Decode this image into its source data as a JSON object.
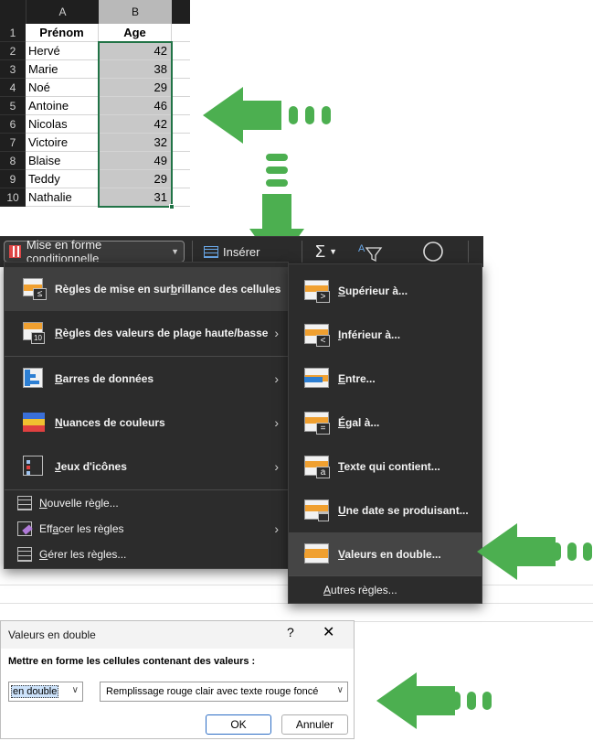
{
  "sheet": {
    "columns": [
      "A",
      "B"
    ],
    "header_row": {
      "num": "1",
      "a": "Prénom",
      "b": "Age"
    },
    "rows": [
      {
        "num": "2",
        "name": "Hervé",
        "age": "42"
      },
      {
        "num": "3",
        "name": "Marie",
        "age": "38"
      },
      {
        "num": "4",
        "name": "Noé",
        "age": "29"
      },
      {
        "num": "5",
        "name": "Antoine",
        "age": "46"
      },
      {
        "num": "6",
        "name": "Nicolas",
        "age": "42"
      },
      {
        "num": "7",
        "name": "Victoire",
        "age": "32"
      },
      {
        "num": "8",
        "name": "Blaise",
        "age": "49"
      },
      {
        "num": "9",
        "name": "Teddy",
        "age": "29"
      },
      {
        "num": "10",
        "name": "Nathalie",
        "age": "31"
      }
    ]
  },
  "ribbon": {
    "conditional_formatting": "Mise en forme conditionnelle",
    "insert": "Insérer",
    "sum_symbol": "Σ"
  },
  "main_menu": {
    "items": [
      {
        "pre": "Règles de mise en sur",
        "key": "b",
        "post": "rillance des cellules"
      },
      {
        "pre": "",
        "key": "R",
        "post": "ègles des valeurs de plage haute/basse"
      },
      {
        "pre": "",
        "key": "B",
        "post": "arres de données"
      },
      {
        "pre": "",
        "key": "N",
        "post": "uances de couleurs"
      },
      {
        "pre": "",
        "key": "J",
        "post": "eux d'icônes"
      }
    ],
    "small_items": [
      {
        "pre": "",
        "key": "N",
        "post": "ouvelle règle..."
      },
      {
        "pre": "Eff",
        "key": "a",
        "post": "cer les règles"
      },
      {
        "pre": "",
        "key": "G",
        "post": "érer les règles..."
      }
    ]
  },
  "sub_menu": {
    "items": [
      {
        "pre": "",
        "key": "S",
        "post": "upérieur à...",
        "badge": ">"
      },
      {
        "pre": "",
        "key": "I",
        "post": "nférieur à...",
        "badge": "<"
      },
      {
        "pre": "",
        "key": "E",
        "post": "ntre...",
        "badge": ""
      },
      {
        "pre": "",
        "key": "É",
        "post": "gal à...",
        "badge": "="
      },
      {
        "pre": "",
        "key": "T",
        "post": "exte qui contient...",
        "badge": "a"
      },
      {
        "pre": "",
        "key": "U",
        "post": "ne date se produisant...",
        "badge": ""
      },
      {
        "pre": "",
        "key": "V",
        "post": "aleurs en double...",
        "badge": ""
      }
    ],
    "more": {
      "pre": "",
      "key": "A",
      "post": "utres règles..."
    }
  },
  "dialog": {
    "title": "Valeurs en double",
    "help": "?",
    "close": "✕",
    "prompt": "Mettre en forme les cellules contenant des valeurs :",
    "type_value": "en double",
    "format_value": "Remplissage rouge clair avec texte rouge foncé",
    "ok": "OK",
    "cancel": "Annuler"
  },
  "colors": {
    "accent_arrow": "#4caf50",
    "selection": "#217346",
    "menu_bg": "#2c2c2c",
    "icon_orange": "#f0a030"
  }
}
